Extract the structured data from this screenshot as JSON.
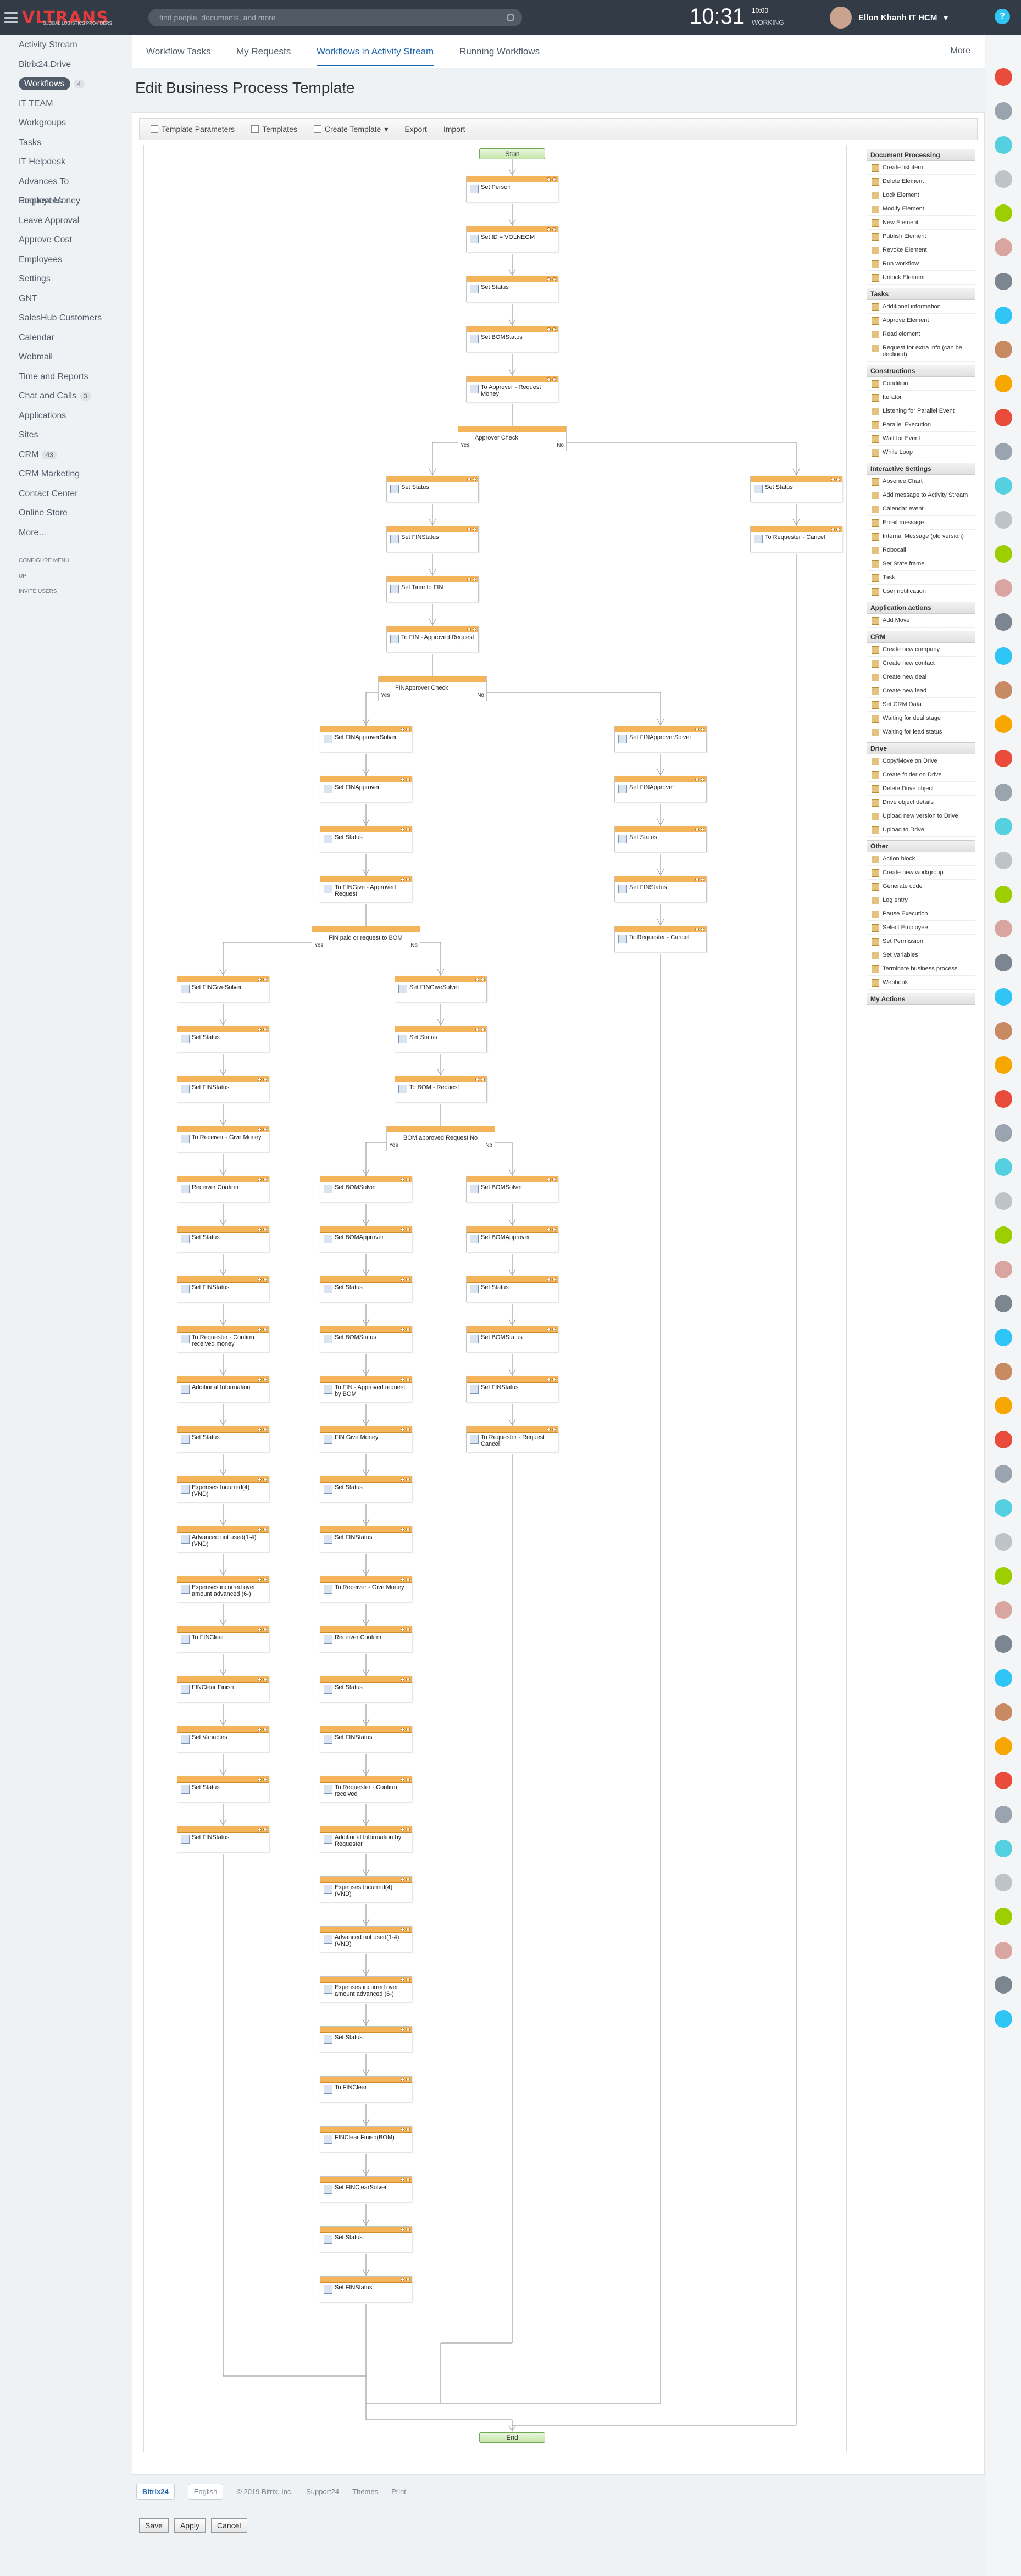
{
  "header": {
    "logo": "VLTRANS",
    "logo_sub": "GLOBAL LOGISTICS PROVIDERS",
    "search_placeholder": "find people, documents, and more",
    "clock": "10:31",
    "flag": "10:00",
    "status": "WORKING",
    "user": "Ellon Khanh IT HCM"
  },
  "leftnav": {
    "items": [
      {
        "label": "Activity Stream"
      },
      {
        "label": "Bitrix24.Drive"
      },
      {
        "label": "Workflows",
        "count": "4",
        "active": true
      },
      {
        "label": "IT TEAM"
      },
      {
        "label": "Workgroups"
      },
      {
        "label": "Tasks"
      },
      {
        "label": "IT Helpdesk"
      },
      {
        "label": "Advances To Employees"
      },
      {
        "label": "Request Money"
      },
      {
        "label": "Leave Approval"
      },
      {
        "label": "Approve Cost"
      },
      {
        "label": "Employees"
      },
      {
        "label": "Settings"
      },
      {
        "label": "GNT"
      },
      {
        "label": "SalesHub Customers"
      },
      {
        "label": "Calendar"
      },
      {
        "label": "Webmail"
      },
      {
        "label": "Time and Reports"
      },
      {
        "label": "Chat and Calls",
        "count": "3"
      },
      {
        "label": "Applications"
      },
      {
        "label": "Sites"
      },
      {
        "label": "CRM",
        "count": "43"
      },
      {
        "label": "CRM Marketing"
      },
      {
        "label": "Contact Center"
      },
      {
        "label": "Online Store"
      },
      {
        "label": "More..."
      }
    ],
    "configure": "CONFIGURE MENU",
    "invite": "INVITE USERS",
    "up": "UP"
  },
  "topnav": {
    "tabs": [
      "Workflow Tasks",
      "My Requests",
      "Workflows in Activity Stream",
      "Running Workflows"
    ],
    "more": "More"
  },
  "page": {
    "title": "Edit Business Process Template"
  },
  "toolbar": {
    "items": [
      "Template Parameters",
      "Templates",
      "Create Template",
      "Export",
      "Import"
    ]
  },
  "process": {
    "start": "Start",
    "end": "End",
    "yes": "Yes",
    "no": "No",
    "center": [
      "Set Person",
      "Set ID = VOLNEGM",
      "Set Status",
      "Set BOMStatus",
      "To Approver - Request Money"
    ],
    "cond1": "Approver Check",
    "left1": [
      "Set Status",
      "Set FINStatus",
      "Set Time to FIN",
      "To FIN - Approved Request"
    ],
    "right1": [
      "Set Status",
      "To Requester - Cancel"
    ],
    "cond2": "FINApprover Check",
    "l2": [
      "Set FINApproverSolver",
      "Set FINApprover",
      "Set Status",
      "To FINGive - Approved Request"
    ],
    "r2": [
      "Set FINApproverSolver",
      "Set FINApprover",
      "Set Status",
      "Set FINStatus",
      "To Requester - Cancel"
    ],
    "cond3": "FIN paid or request to BOM",
    "l3": [
      "Set FINGiveSolver",
      "Set Status",
      "Set FINStatus",
      "To Receiver - Give Money",
      "Receiver Confirm",
      "Set Status",
      "Set FINStatus",
      "To Requester - Confirm received money",
      "Additional Information",
      "Set Status",
      "Expenses Incurred(4) (VND)",
      "Advanced not used(1-4) (VND)",
      "Expenses incurred over amount advanced (6-)",
      "To FINClear",
      "FINClear Finish",
      "Set Variables",
      "Set Status",
      "Set FINStatus"
    ],
    "m3": [
      "Set FINGiveSolver",
      "Set Status",
      "To BOM - Request"
    ],
    "cond4": "BOM approved Request No",
    "m4": [
      "Set BOMSolver",
      "Set BOMApprover",
      "Set Status",
      "Set BOMStatus",
      "To FIN - Approved request by BOM",
      "FIN Give Money",
      "Set Status",
      "Set FINStatus",
      "To Receiver - Give Money",
      "Receiver Confirm",
      "Set Status",
      "Set FINStatus",
      "To Requester - Confirm received",
      "Additional Information by Requester",
      "Expenses Incurred(4) (VND)",
      "Advanced not used(1-4) (VND)",
      "Expenses incurred over amount advanced (6-)",
      "Set Status",
      "To FINClear",
      "FINClear Finish(BOM)",
      "Set FINClearSolver",
      "Set Status",
      "Set FINStatus"
    ],
    "r4": [
      "Set BOMSolver",
      "Set BOMApprover",
      "Set Status",
      "Set BOMStatus",
      "Set FINStatus",
      "To Requester - Request Cancel"
    ]
  },
  "palette": [
    {
      "title": "Document Processing",
      "items": [
        "Create list item",
        "Delete Element",
        "Lock Element",
        "Modify Element",
        "New Element",
        "Publish Element",
        "Revoke Element",
        "Run workflow",
        "Unlock Element"
      ]
    },
    {
      "title": "Tasks",
      "items": [
        "Additional information",
        "Approve Element",
        "Read element",
        "Request for extra info (can be declined)"
      ]
    },
    {
      "title": "Constructions",
      "items": [
        "Condition",
        "Iterator",
        "Listening for Parallel Event",
        "Parallel Execution",
        "Wait for Event",
        "While Loop"
      ]
    },
    {
      "title": "Interactive Settings",
      "items": [
        "Absence Chart",
        "Add message to Activity Stream",
        "Calendar event",
        "Email message",
        "Internal Message (old version)",
        "Robocall",
        "Set State frame",
        "Task",
        "User notification"
      ]
    },
    {
      "title": "Application actions",
      "items": [
        "Add Move"
      ]
    },
    {
      "title": "CRM",
      "items": [
        "Create new company",
        "Create new contact",
        "Create new deal",
        "Create new lead",
        "Set CRM Data",
        "Waiting for deal stage",
        "Waiting for lead status"
      ]
    },
    {
      "title": "Drive",
      "items": [
        "Copy/Move on Drive",
        "Create folder on Drive",
        "Delete Drive object",
        "Drive object details",
        "Upload new version to Drive",
        "Upload to Drive"
      ]
    },
    {
      "title": "Other",
      "items": [
        "Action block",
        "Create new workgroup",
        "Generate code",
        "Log entry",
        "Pause Execution",
        "Select Employee",
        "Set Permission",
        "Set Variables",
        "Terminate business process",
        "Webhook"
      ]
    },
    {
      "title": "My Actions",
      "items": []
    }
  ],
  "buttons": {
    "save": "Save",
    "apply": "Apply",
    "cancel": "Cancel"
  },
  "footer": {
    "brand": "Bitrix24",
    "lang": "English",
    "copy": "© 2019 Bitrix, Inc.",
    "support": "Support24",
    "themes": "Themes",
    "print": "Print"
  }
}
